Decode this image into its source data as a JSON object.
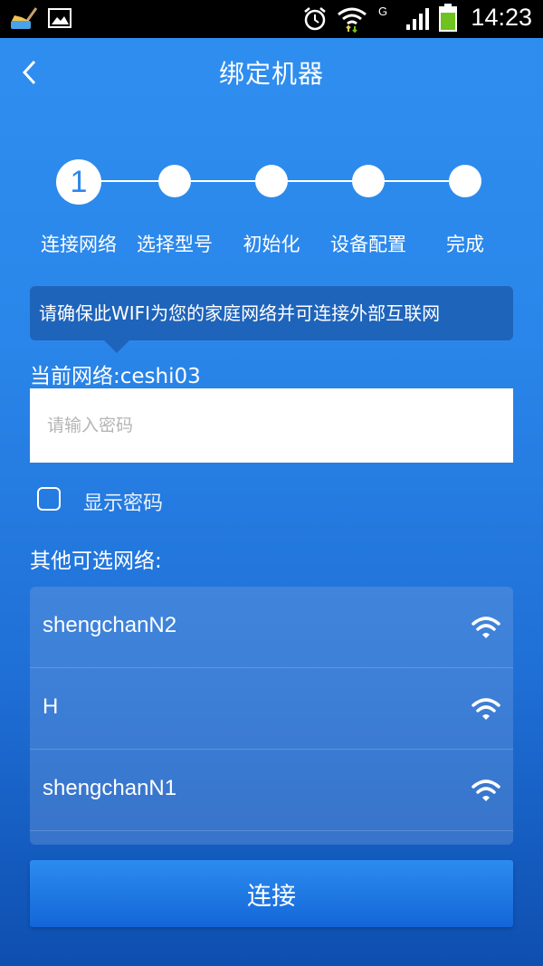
{
  "status_bar": {
    "time": "14:23",
    "network_type": "G"
  },
  "header": {
    "title": "绑定机器"
  },
  "stepper": {
    "active_number": "1",
    "steps": [
      {
        "label": "连接网络"
      },
      {
        "label": "选择型号"
      },
      {
        "label": "初始化"
      },
      {
        "label": "设备配置"
      },
      {
        "label": "完成"
      }
    ]
  },
  "tip": "请确保此WIFI为您的家庭网络并可连接外部互联网",
  "current_network": "当前网络:ceshi03",
  "password": {
    "value": "",
    "placeholder": "请输入密码"
  },
  "show_password": {
    "label": "显示密码",
    "checked": false
  },
  "other_networks": {
    "label": "其他可选网络:",
    "items": [
      {
        "name": "shengchanN2",
        "icon": "wifi-icon"
      },
      {
        "name": "H",
        "icon": "wifi-icon"
      },
      {
        "name": "shengchanN1",
        "icon": "wifi-icon"
      }
    ]
  },
  "connect_button": "连接",
  "colors": {
    "background_top": "#2f8ff0",
    "background_bottom": "#0e4fb0",
    "tooltip": "#1f64bb",
    "status_bar": "#000000",
    "battery": "#6fc21f"
  }
}
